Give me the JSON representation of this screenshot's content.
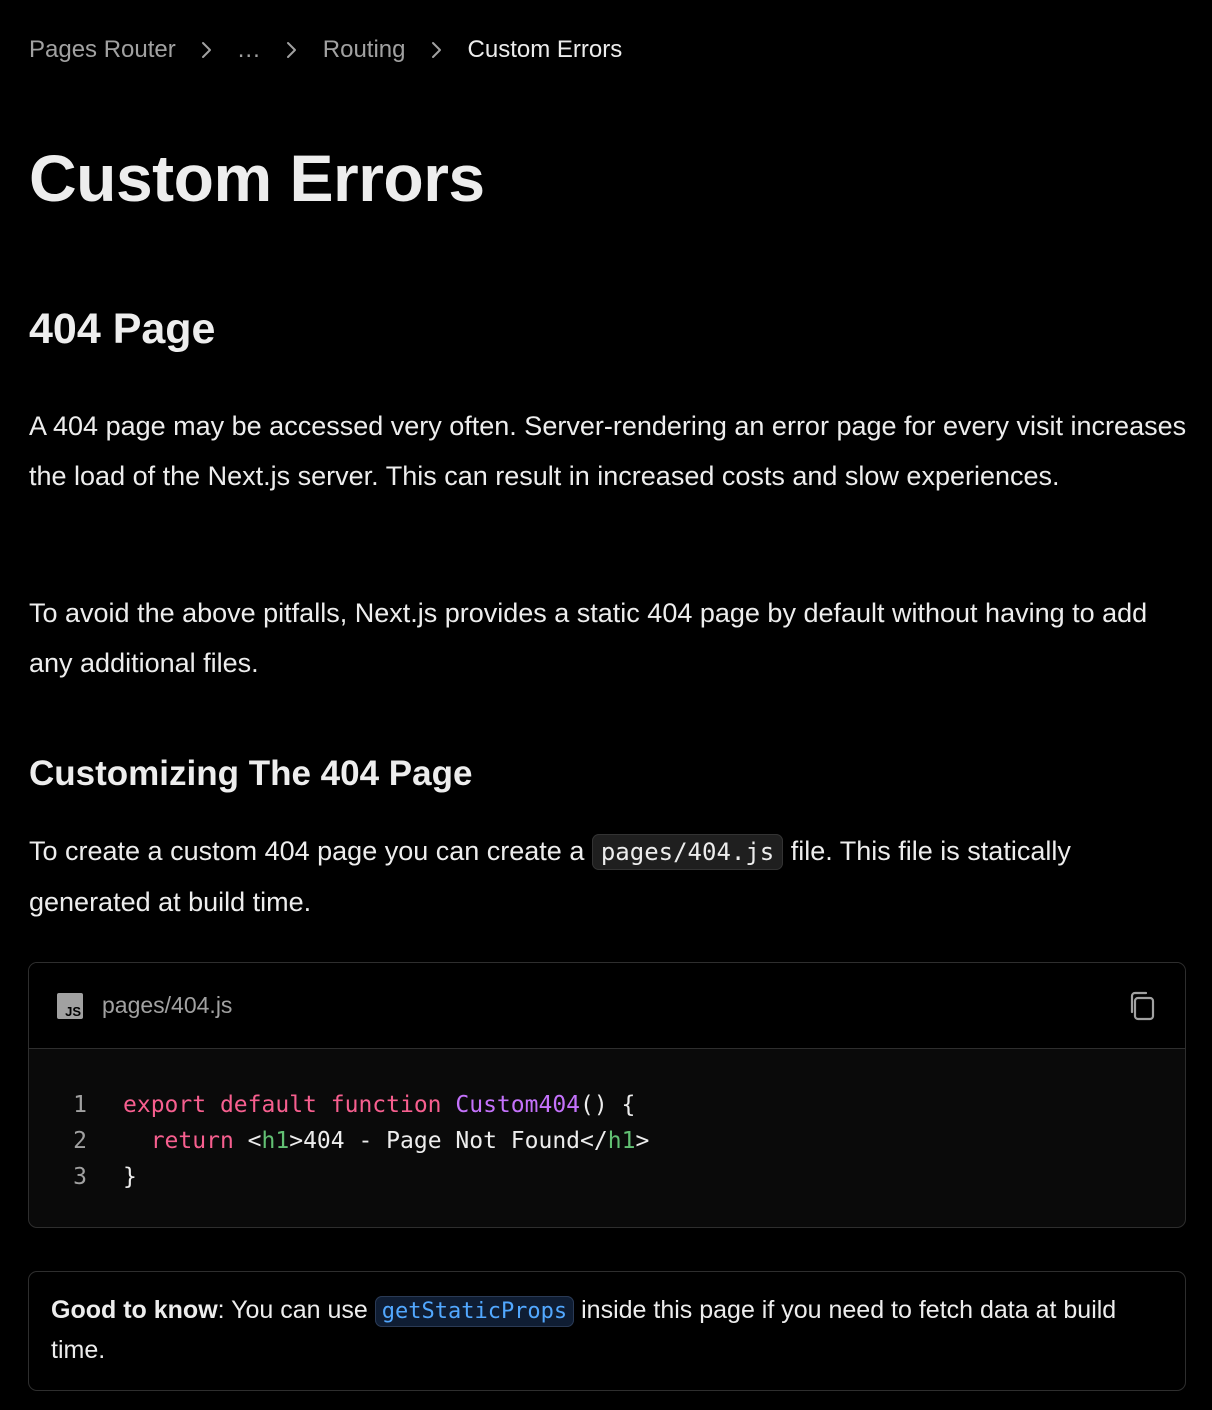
{
  "breadcrumb": {
    "items": [
      "Pages Router",
      "...",
      "Routing"
    ],
    "current": "Custom Errors"
  },
  "page_title": "Custom Errors",
  "section": {
    "title": "404 Page",
    "paragraph_1": "A 404 page may be accessed very often. Server-rendering an error page for every visit increases the load of the Next.js server. This can result in increased costs and slow experiences.",
    "paragraph_2": "To avoid the above pitfalls, Next.js provides a static 404 page by default without having to add any additional files."
  },
  "subsection": {
    "title": "Customizing The 404 Page",
    "text_before_code": "To create a custom 404 page you can create a ",
    "inline_code": "pages/404.js",
    "text_after_code": " file. This file is statically generated at build time."
  },
  "code_block": {
    "language_icon": "js-icon",
    "language_label": "JS",
    "filename": "pages/404.js",
    "copy_icon": "copy-icon",
    "line_numbers": [
      "1",
      "2",
      "3"
    ],
    "lines": [
      {
        "kw1": "export",
        "kw2": "default",
        "kw3": "function",
        "fn": "Custom404",
        "rest": "() {"
      },
      {
        "kw": "return",
        "open_lt": "<",
        "open_tag": "h1",
        "open_gt": ">",
        "text": "404 - Page Not Found",
        "close_lt": "</",
        "close_tag": "h1",
        "close_gt": ">"
      },
      {
        "text": "}"
      }
    ],
    "colors": {
      "keyword": "#f75f8f",
      "function": "#c472fb",
      "tag": "#62c073",
      "text": "#ededed"
    }
  },
  "callout": {
    "label": "Good to know",
    "text_before_code": ": You can use ",
    "inline_code": "getStaticProps",
    "text_after_code": " inside this page if you need to fetch data at build time."
  }
}
